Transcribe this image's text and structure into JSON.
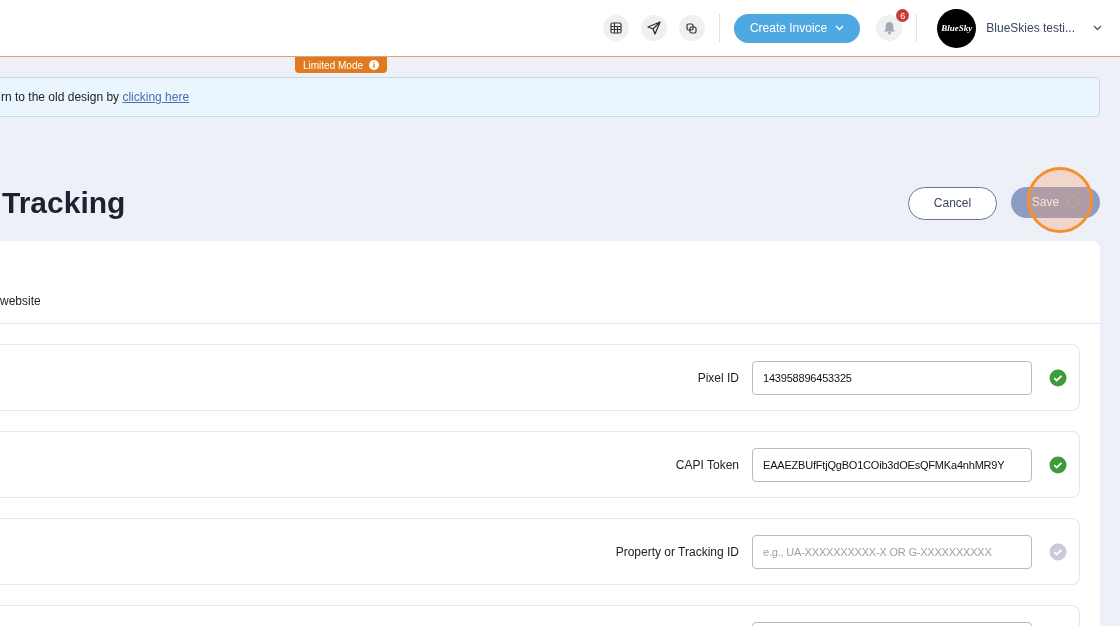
{
  "topbar": {
    "icon_buttons": [
      {
        "kind": "grid"
      },
      {
        "kind": "send"
      },
      {
        "kind": "copy"
      }
    ],
    "create_button": "Create Invoice",
    "notifications": {
      "count": "6"
    },
    "account": {
      "avatar_text": "BlueSky",
      "name": "BlueSkies testi..."
    }
  },
  "limited_mode": {
    "label": "Limited Mode"
  },
  "banner": {
    "text": "rn to the old design by ",
    "link": "clicking here"
  },
  "header": {
    "title": "Tracking",
    "cancel": "Cancel",
    "save": "Save",
    "save_disabled": true,
    "save_loading": true
  },
  "section": {
    "subtitle": "website"
  },
  "fields": [
    {
      "kind": "labeled",
      "label": "Pixel ID",
      "value": "143958896453325",
      "verified": true
    },
    {
      "kind": "labeled",
      "label": "CAPI Token",
      "value": "EAAEZBUfFtjQgBO1COib3dOEsQFMKa4nhMR9Y",
      "verified": true
    },
    {
      "kind": "labeled",
      "label": "Property or Tracking ID",
      "placeholder": "e.g., UA-XXXXXXXXXX-X OR G-XXXXXXXXXX",
      "verified": false
    },
    {
      "kind": "cut_off"
    }
  ]
}
